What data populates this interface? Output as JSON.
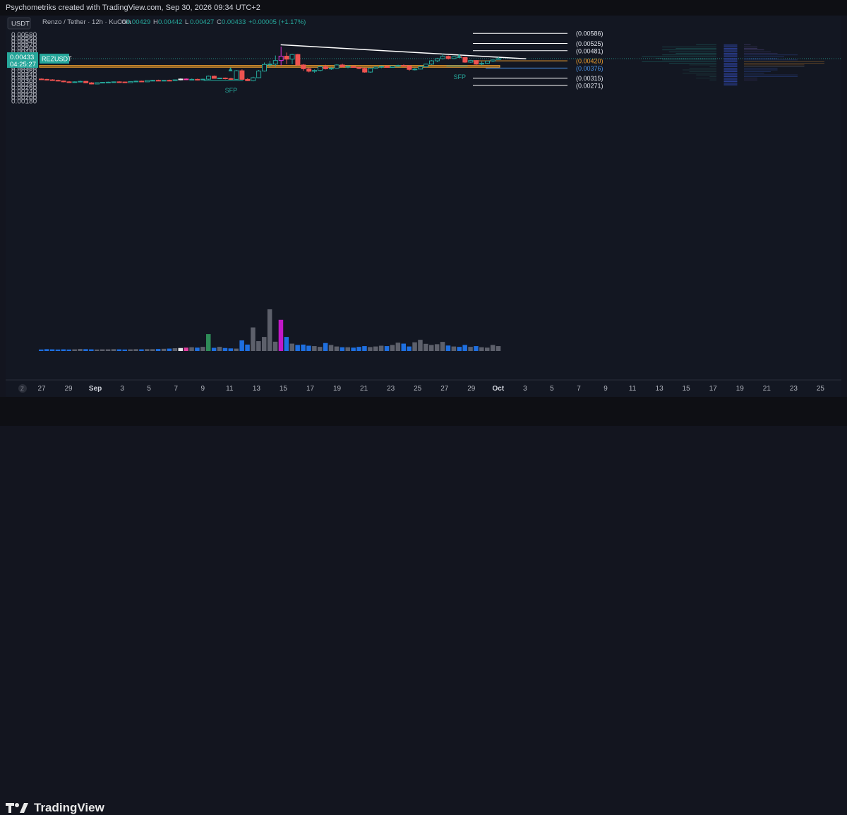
{
  "header": {
    "text": "Psychometriks created with TradingView.com, Sep 30, 2026 09:34 UTC+2"
  },
  "chart_data": {
    "type": "candlestick",
    "currency_badge": "USDT",
    "legend": {
      "title": "Renzo / Tether · 12h · KuCoin",
      "ohlc": [
        {
          "k": "O",
          "v": "0.00429"
        },
        {
          "k": "H",
          "v": "0.00442"
        },
        {
          "k": "L",
          "v": "0.00427"
        },
        {
          "k": "C",
          "v": "0.00433"
        }
      ],
      "change": "+0.00005 (+1.17%)"
    },
    "y_range": [
      0.0017,
      0.0059
    ],
    "y_ticks": [
      "0.00580",
      "0.00560",
      "0.00540",
      "0.00520",
      "0.00500",
      "0.00480",
      "0.00460",
      "0.00440",
      "0.00400",
      "0.00380",
      "0.00360",
      "0.00340",
      "0.00320",
      "0.00300",
      "0.00280",
      "0.00260",
      "0.00240",
      "0.00220",
      "0.00200",
      "0.00180"
    ],
    "x_tick_labels": [
      "27",
      "29",
      "Sep",
      "3",
      "5",
      "7",
      "9",
      "11",
      "13",
      "15",
      "17",
      "19",
      "21",
      "23",
      "25",
      "27",
      "29",
      "Oct",
      "3",
      "5",
      "7",
      "9",
      "11",
      "13",
      "15",
      "17",
      "19",
      "21",
      "23",
      "25"
    ],
    "x_axis_left_symbol": "Z",
    "last_price": {
      "value": "0.00433",
      "countdown": "04:25:27",
      "symbol": "REZUSDT"
    },
    "candles": [
      [
        0.0031,
        0.00313,
        0.00305,
        0.00308
      ],
      [
        0.00308,
        0.00311,
        0.00302,
        0.00305
      ],
      [
        0.00305,
        0.00309,
        0.003,
        0.00302
      ],
      [
        0.00302,
        0.00306,
        0.00296,
        0.00298
      ],
      [
        0.00298,
        0.00301,
        0.0029,
        0.00293
      ],
      [
        0.00293,
        0.00297,
        0.00287,
        0.0029
      ],
      [
        0.0029,
        0.00296,
        0.00287,
        0.00293
      ],
      [
        0.00293,
        0.003,
        0.0029,
        0.00296
      ],
      [
        0.00296,
        0.00298,
        0.00285,
        0.00287
      ],
      [
        0.00287,
        0.00291,
        0.00278,
        0.0028
      ],
      [
        0.0028,
        0.0029,
        0.00278,
        0.00288
      ],
      [
        0.00288,
        0.00292,
        0.00284,
        0.0029
      ],
      [
        0.0029,
        0.00294,
        0.00286,
        0.00291
      ],
      [
        0.00291,
        0.00295,
        0.00288,
        0.00293
      ],
      [
        0.00293,
        0.00296,
        0.00289,
        0.00292
      ],
      [
        0.00292,
        0.00294,
        0.00286,
        0.00288
      ],
      [
        0.00288,
        0.00296,
        0.00286,
        0.00295
      ],
      [
        0.00295,
        0.003,
        0.00292,
        0.00297
      ],
      [
        0.00297,
        0.003,
        0.00292,
        0.00293
      ],
      [
        0.00293,
        0.00303,
        0.00292,
        0.00301
      ],
      [
        0.00301,
        0.00305,
        0.00298,
        0.00302
      ],
      [
        0.00302,
        0.00306,
        0.00298,
        0.003
      ],
      [
        0.003,
        0.00304,
        0.00296,
        0.00302
      ],
      [
        0.00302,
        0.00306,
        0.00298,
        0.00301
      ],
      [
        0.00301,
        0.00307,
        0.00299,
        0.00305
      ],
      [
        0.00305,
        0.00313,
        0.00302,
        0.0031
      ],
      [
        0.0031,
        0.00314,
        0.00304,
        0.00308
      ],
      [
        0.00308,
        0.00313,
        0.00304,
        0.00308
      ],
      [
        0.00308,
        0.00312,
        0.00302,
        0.00306
      ],
      [
        0.00306,
        0.00312,
        0.00302,
        0.00309
      ],
      [
        0.00309,
        0.00331,
        0.00306,
        0.00327
      ],
      [
        0.00327,
        0.00331,
        0.00313,
        0.00314
      ],
      [
        0.00314,
        0.00318,
        0.0031,
        0.00316
      ],
      [
        0.00316,
        0.00319,
        0.00308,
        0.00312
      ],
      [
        0.00312,
        0.00318,
        0.00305,
        0.00308
      ],
      [
        0.00308,
        0.00365,
        0.00305,
        0.0036
      ],
      [
        0.0036,
        0.00368,
        0.00305,
        0.00308
      ],
      [
        0.00308,
        0.00315,
        0.00298,
        0.003
      ],
      [
        0.003,
        0.00324,
        0.00296,
        0.00318
      ],
      [
        0.00318,
        0.00365,
        0.00315,
        0.00358
      ],
      [
        0.00358,
        0.0041,
        0.00355,
        0.00398
      ],
      [
        0.00398,
        0.0042,
        0.00382,
        0.004
      ],
      [
        0.004,
        0.00452,
        0.00385,
        0.00422
      ],
      [
        0.00422,
        0.00506,
        0.00392,
        0.00448
      ],
      [
        0.00448,
        0.0047,
        0.004,
        0.0043
      ],
      [
        0.0043,
        0.00462,
        0.004,
        0.00458
      ],
      [
        0.00458,
        0.00462,
        0.0039,
        0.00395
      ],
      [
        0.00395,
        0.004,
        0.0036,
        0.00372
      ],
      [
        0.00372,
        0.00378,
        0.0035,
        0.00357
      ],
      [
        0.00357,
        0.00368,
        0.00348,
        0.00362
      ],
      [
        0.00362,
        0.00388,
        0.00356,
        0.00384
      ],
      [
        0.00384,
        0.00396,
        0.00368,
        0.00372
      ],
      [
        0.00372,
        0.00382,
        0.00365,
        0.00375
      ],
      [
        0.00375,
        0.004,
        0.00372,
        0.00395
      ],
      [
        0.00395,
        0.00402,
        0.0038,
        0.00384
      ],
      [
        0.00384,
        0.00392,
        0.00375,
        0.00386
      ],
      [
        0.00386,
        0.00388,
        0.00378,
        0.0038
      ],
      [
        0.0038,
        0.00384,
        0.0037,
        0.00374
      ],
      [
        0.00374,
        0.00378,
        0.00348,
        0.00352
      ],
      [
        0.00352,
        0.00378,
        0.00348,
        0.00375
      ],
      [
        0.00375,
        0.00385,
        0.00372,
        0.00382
      ],
      [
        0.00382,
        0.0039,
        0.00376,
        0.00386
      ],
      [
        0.00386,
        0.00392,
        0.00378,
        0.0038
      ],
      [
        0.0038,
        0.0039,
        0.00378,
        0.00388
      ],
      [
        0.00388,
        0.00396,
        0.00384,
        0.00392
      ],
      [
        0.00392,
        0.00398,
        0.00386,
        0.00389
      ],
      [
        0.00389,
        0.00392,
        0.0036,
        0.00368
      ],
      [
        0.00368,
        0.00376,
        0.00362,
        0.0037
      ],
      [
        0.0037,
        0.00388,
        0.00368,
        0.00384
      ],
      [
        0.00384,
        0.00403,
        0.0038,
        0.004
      ],
      [
        0.004,
        0.00424,
        0.00396,
        0.0042
      ],
      [
        0.0042,
        0.00438,
        0.00412,
        0.00433
      ],
      [
        0.00433,
        0.00463,
        0.00428,
        0.00447
      ],
      [
        0.00447,
        0.00452,
        0.00428,
        0.00434
      ],
      [
        0.00434,
        0.00448,
        0.0043,
        0.00445
      ],
      [
        0.00445,
        0.0045,
        0.00436,
        0.0044
      ],
      [
        0.0044,
        0.00444,
        0.00408,
        0.00412
      ],
      [
        0.00412,
        0.00426,
        0.00408,
        0.00422
      ],
      [
        0.00422,
        0.00424,
        0.00396,
        0.004
      ],
      [
        0.004,
        0.00416,
        0.00392,
        0.00405
      ],
      [
        0.00405,
        0.0042,
        0.00402,
        0.00418
      ],
      [
        0.00418,
        0.00428,
        0.00412,
        0.00425
      ],
      [
        0.00429,
        0.00442,
        0.00427,
        0.00433
      ]
    ],
    "volume": {
      "max": 210,
      "values": [
        4,
        6,
        5,
        4,
        5,
        4,
        5,
        7,
        6,
        5,
        4,
        5,
        5,
        6,
        5,
        4,
        5,
        6,
        5,
        6,
        6,
        7,
        8,
        9,
        11,
        12,
        14,
        16,
        14,
        18,
        85,
        13,
        18,
        12,
        10,
        9,
        52,
        30,
        120,
        48,
        70,
        215,
        45,
        160,
        70,
        35,
        28,
        30,
        24,
        22,
        18,
        38,
        28,
        20,
        16,
        16,
        14,
        18,
        22,
        17,
        20,
        24,
        22,
        28,
        40,
        35,
        20,
        42,
        55,
        34,
        28,
        32,
        44,
        25,
        20,
        18,
        28,
        18,
        22,
        16,
        14,
        28,
        22
      ],
      "colors": {
        "up": "#5d606b",
        "down": "#1e6fe0",
        "green": "#2e8b57",
        "magenta": "#c218c8",
        "white": "#e6e6e6",
        "pink": "#e040a0"
      }
    },
    "candle_colors": {
      "up": "#26a69a",
      "down": "#ef5350",
      "magenta": "#d932d4",
      "white": "#f0f0f0",
      "pink": "#ff3fb0"
    },
    "levels": [
      {
        "label": "(0.00586)",
        "value": 0.00586,
        "color": "#ffffff"
      },
      {
        "label": "(0.00525)",
        "value": 0.00525,
        "color": "#ffffff"
      },
      {
        "label": "(0.00481)",
        "value": 0.00481,
        "color": "#ffffff"
      },
      {
        "label": "(0.00420)",
        "value": 0.0042,
        "color": "#f0a030"
      },
      {
        "label": "(0.00376)",
        "value": 0.00376,
        "color": "#4a90e2"
      },
      {
        "label": "(0.00315)",
        "value": 0.00315,
        "color": "#ffffff"
      },
      {
        "label": "(0.00271)",
        "value": 0.00271,
        "color": "#ffffff"
      }
    ],
    "support_zone": {
      "low": 0.00381,
      "high": 0.00392,
      "color": "#f0a030"
    },
    "trendline": {
      "from": {
        "candle": 43,
        "value": 0.00517
      },
      "to": {
        "candle": 87,
        "value": 0.00432
      },
      "color": "#ffffff"
    },
    "annotations": [
      {
        "text": "SFP",
        "candle": 34,
        "value": 0.00288
      },
      {
        "text": "SFP",
        "candle": 75,
        "value": 0.00369
      }
    ],
    "volume_profile": {
      "rows": 25,
      "top_value": 0.0052,
      "row_height_value": 0.0001,
      "left_bars": [
        3,
        8,
        6,
        8,
        7,
        6,
        8,
        11,
        9,
        8,
        11,
        7,
        4,
        1,
        4,
        5,
        4,
        5,
        3,
        1,
        3,
        1,
        0,
        0,
        0
      ],
      "left_colors": [
        "#26a69a",
        "#2a6f68"
      ],
      "right_bars": [
        1,
        2,
        2,
        3,
        4,
        5,
        8,
        6,
        5,
        8,
        12,
        12,
        9,
        9,
        5,
        5,
        4,
        3,
        8,
        8,
        2,
        2,
        0,
        0,
        0
      ],
      "right_colors": [
        "#7b6bc8",
        "#5a4fa8",
        "#3a5fcf",
        "#f0a030",
        "#e08a20",
        "#7a7a84",
        "#ad1457"
      ]
    }
  }
}
